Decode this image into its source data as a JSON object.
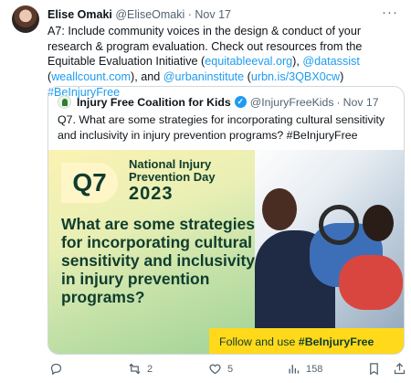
{
  "tweet": {
    "author_name": "Elise Omaki",
    "author_handle": "@EliseOmaki",
    "separator": "·",
    "date": "Nov 17",
    "more_icon": "more-icon",
    "text": {
      "t1": "A7: Include community voices in the design & conduct of your research & program evaluation. Check out resources from the Equitable Evaluation Initiative (",
      "l1": "equitableeval.org",
      "t2": "), ",
      "l2": "@datassist",
      "t3": " (",
      "l3": "weallcount.com",
      "t4": "), and ",
      "l4": "@urbaninstitute",
      "t5": " (",
      "l5": "urbn.is/3QBX0cw",
      "t6": ") ",
      "l6": "#BeInjuryFree"
    }
  },
  "quote": {
    "name": "Injury Free Coalition for Kids",
    "handle": "@InjuryFreeKids",
    "separator": "·",
    "date": "Nov 17",
    "verified_icon": "verified-badge-icon",
    "text": "Q7. What are some strategies for incorporating cultural sensitivity and inclusivity in injury prevention programs? #BeInjuryFree",
    "promo": {
      "badge": "Q7",
      "event_line1": "National Injury",
      "event_line2": "Prevention Day",
      "year": "2023",
      "headline": "What are some strategies for incorporating cultural sensitivity and inclusivity in injury prevention programs?",
      "follow_text": "Follow and use ",
      "follow_tag": "#BeInjuryFree"
    }
  },
  "actions": {
    "reply_icon": "reply-icon",
    "reply_count": "",
    "retweet_icon": "retweet-icon",
    "retweet_count": "2",
    "like_icon": "heart-icon",
    "like_count": "5",
    "views_icon": "views-icon",
    "views_count": "158",
    "bookmark_icon": "bookmark-icon",
    "share_icon": "share-icon"
  },
  "colors": {
    "link": "#1d9bf0",
    "muted": "#536471",
    "follow_bar": "#ffd91a",
    "promo_text": "#0f3d2e"
  }
}
